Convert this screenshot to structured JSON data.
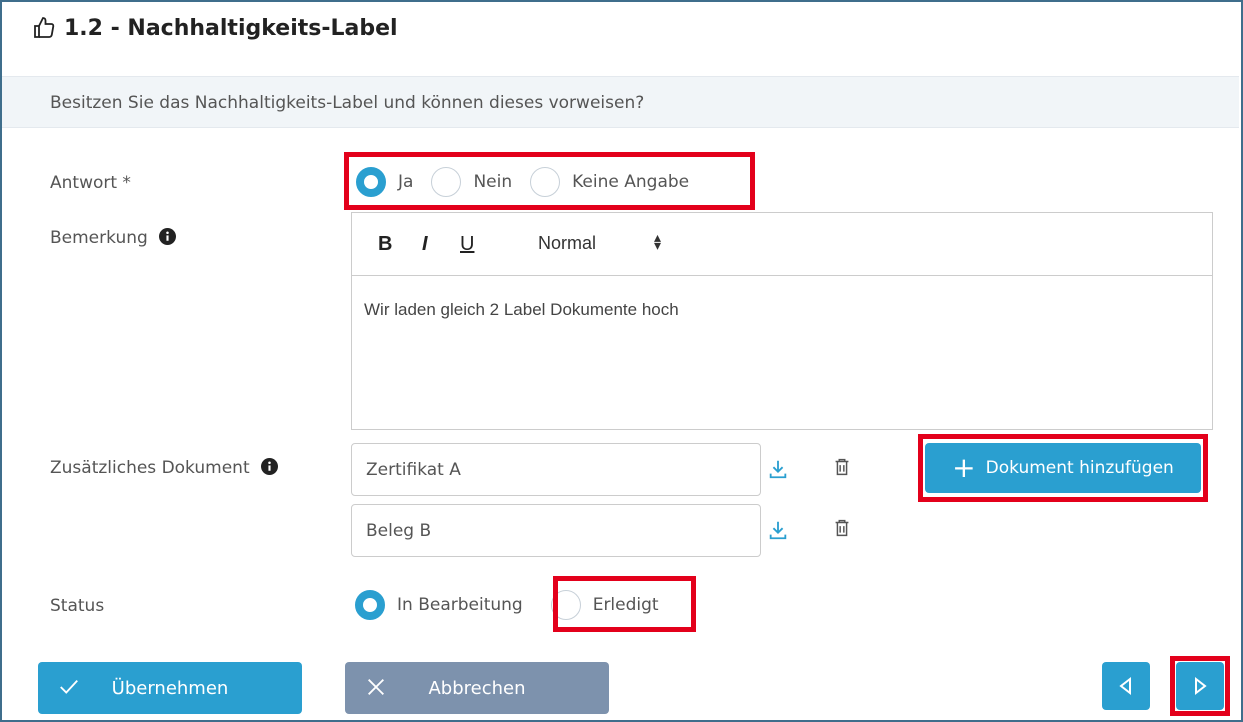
{
  "header": {
    "icon": "thumbs-up-icon",
    "title": "1.2 - Nachhaltigkeits-Label"
  },
  "question": "Besitzen Sie das Nachhaltigkeits-Label und können dieses vorweisen?",
  "answer": {
    "label": "Antwort *",
    "options": [
      "Ja",
      "Nein",
      "Keine Angabe"
    ],
    "selected": "Ja"
  },
  "remark": {
    "label": "Bemerkung",
    "toolbar": {
      "bold": "B",
      "italic": "I",
      "underline": "U",
      "format": "Normal"
    },
    "content": "Wir laden gleich 2 Label Dokumente hoch"
  },
  "documents": {
    "label": "Zusätzliches Dokument",
    "items": [
      "Zertifikat A",
      "Beleg B"
    ],
    "add_button": "Dokument hinzufügen"
  },
  "status": {
    "label": "Status",
    "options": [
      "In Bearbeitung",
      "Erledigt"
    ],
    "selected": "In Bearbeitung"
  },
  "footer": {
    "ok_label": "Übernehmen",
    "cancel_label": "Abbrechen"
  },
  "colors": {
    "accent": "#2a9fd0",
    "cancel": "#7d92ad",
    "highlight": "#e3001b"
  }
}
